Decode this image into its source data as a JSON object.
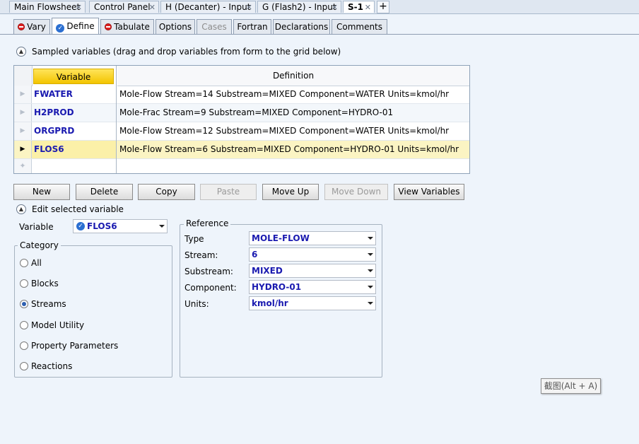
{
  "doc_tabs": [
    {
      "label": "Main Flowsheet",
      "active": false
    },
    {
      "label": "Control Panel",
      "active": false
    },
    {
      "label": "H (Decanter) - Input",
      "active": false
    },
    {
      "label": "G (Flash2) - Input",
      "active": false
    },
    {
      "label": "S-1",
      "active": true
    }
  ],
  "doc_tab_close": "✕",
  "doc_tab_add": "+",
  "form_tabs": [
    {
      "label": "Vary",
      "icon": "status-error-icon"
    },
    {
      "label": "Define",
      "icon": "status-complete-icon",
      "active": true
    },
    {
      "label": "Tabulate",
      "icon": "status-error-icon"
    },
    {
      "label": "Options"
    },
    {
      "label": "Cases",
      "disabled": true
    },
    {
      "label": "Fortran"
    },
    {
      "label": "Declarations"
    },
    {
      "label": "Comments"
    }
  ],
  "sampled_section": {
    "title": "Sampled variables (drag and drop variables from form to the grid below)"
  },
  "grid": {
    "columns": {
      "variable": "Variable",
      "definition": "Definition"
    },
    "rows": [
      {
        "variable": "FWATER",
        "definition": "Mole-Flow Stream=14 Substream=MIXED Component=WATER Units=kmol/hr"
      },
      {
        "variable": "H2PROD",
        "definition": "Mole-Frac Stream=9 Substream=MIXED Component=HYDRO-01"
      },
      {
        "variable": "ORGPRD",
        "definition": "Mole-Flow Stream=12 Substream=MIXED Component=WATER Units=kmol/hr"
      },
      {
        "variable": "FLOS6",
        "definition": "Mole-Flow Stream=6 Substream=MIXED Component=HYDRO-01 Units=kmol/hr"
      }
    ],
    "selected_index": 3
  },
  "buttons": {
    "new": "New",
    "delete": "Delete",
    "copy": "Copy",
    "paste": "Paste",
    "move_up": "Move Up",
    "move_down": "Move Down",
    "view_variables": "View Variables"
  },
  "edit_section": {
    "title": "Edit selected variable",
    "variable_label": "Variable",
    "variable_value": "FLOS6"
  },
  "category": {
    "title": "Category",
    "options": [
      "All",
      "Blocks",
      "Streams",
      "Model Utility",
      "Property Parameters",
      "Reactions"
    ],
    "selected": "Streams"
  },
  "reference": {
    "title": "Reference",
    "fields": [
      {
        "label": "Type",
        "value": "MOLE-FLOW"
      },
      {
        "label": "Stream:",
        "value": "6"
      },
      {
        "label": "Substream:",
        "value": "MIXED"
      },
      {
        "label": "Component:",
        "value": "HYDRO-01"
      },
      {
        "label": "Units:",
        "value": "kmol/hr"
      }
    ]
  },
  "tooltip": {
    "text": "截图(Alt + A)"
  },
  "colors": {
    "accent_blue": "#1a1ab0",
    "header_yellow": "#f3c400",
    "selected_row": "#fbf4c3"
  }
}
